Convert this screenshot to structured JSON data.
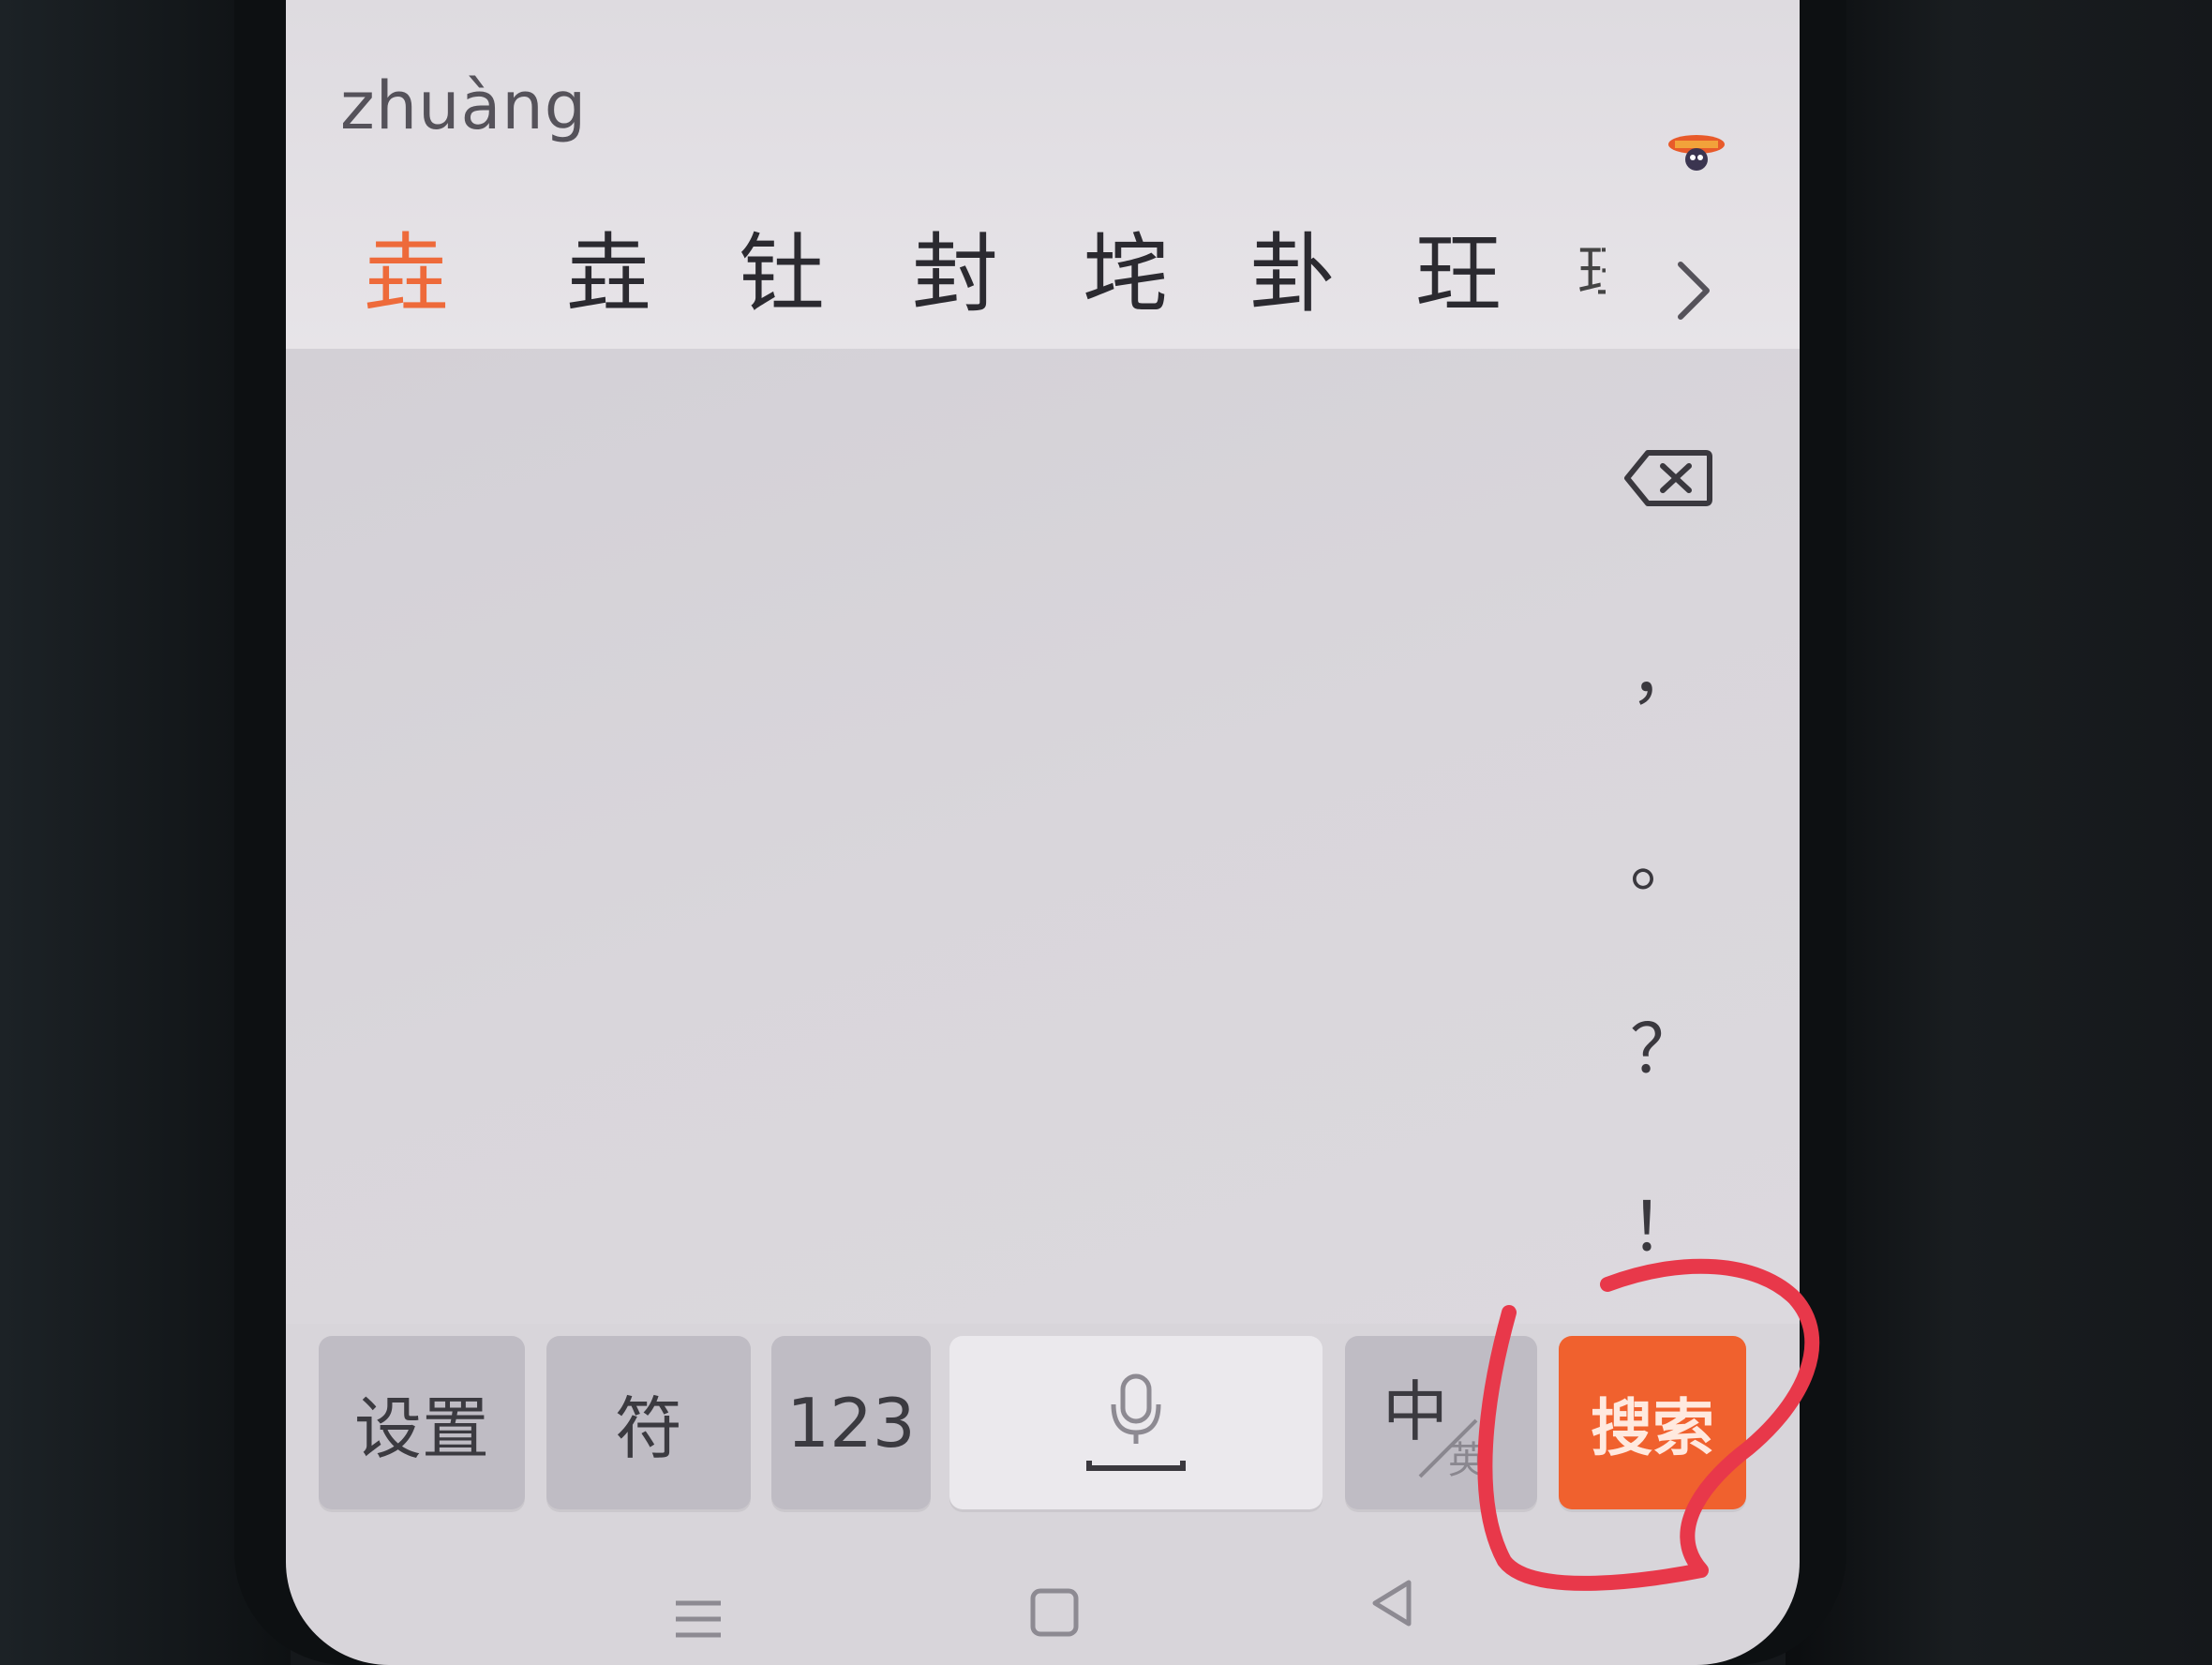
{
  "candidate_bar": {
    "pinyin": "zhuàng",
    "candidates": [
      "垚",
      "垚",
      "钍",
      "封",
      "垞",
      "卦",
      "玨"
    ],
    "partial_candidate": "玨",
    "more_icon": "chevron-right-icon",
    "mascot_icon": "mascot-icon"
  },
  "side_keys": {
    "backspace_icon": "backspace-icon",
    "comma": "，",
    "period": "。",
    "question": "？",
    "exclaim": "！"
  },
  "bottom_keys": {
    "settings": "设置",
    "symbols": "符",
    "numbers": "123",
    "space_mic_icon": "microphone-icon",
    "lang_main": "中",
    "lang_sub": "英",
    "search": "搜索"
  },
  "navbar": {
    "menu_icon": "menu-icon",
    "home_icon": "home-icon",
    "back_icon": "back-icon"
  },
  "colors": {
    "accent": "#f0612e",
    "highlight_candidate": "#ee6a3a",
    "annotation_circle": "#e8384a"
  }
}
